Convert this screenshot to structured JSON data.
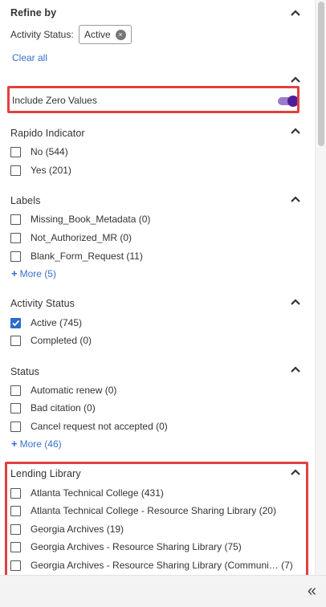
{
  "refine": {
    "title": "Refine by",
    "activity_label": "Activity Status:",
    "chip_value": "Active",
    "chip_remove": "×",
    "clear_all": "Clear all"
  },
  "zero": {
    "label": "Include Zero Values",
    "toggle_on": true
  },
  "rapido": {
    "title": "Rapido Indicator",
    "options": [
      "No (544)",
      "Yes (201)"
    ]
  },
  "labels": {
    "title": "Labels",
    "options": [
      "Missing_Book_Metadata (0)",
      "Not_Authorized_MR (0)",
      "Blank_Form_Request (11)"
    ],
    "more": "More (5)"
  },
  "activity_status": {
    "title": "Activity Status",
    "options": [
      "Active (745)",
      "Completed (0)"
    ],
    "checked": [
      true,
      false
    ]
  },
  "status": {
    "title": "Status",
    "options": [
      "Automatic renew (0)",
      "Bad citation (0)",
      "Cancel request not accepted (0)"
    ],
    "more": "More (46)"
  },
  "lending": {
    "title": "Lending Library",
    "options": [
      "Atlanta Technical College (431)",
      "Atlanta Technical College - Resource Sharing Library (20)",
      "Georgia Archives (19)",
      "Georgia Archives - Resource Sharing Library (75)",
      "Georgia Archives - Resource Sharing Library (Communi…  (7)"
    ]
  },
  "footer": {
    "collapse": "«"
  },
  "colors": {
    "highlight": "#e14040",
    "link": "#3a6fd0",
    "checkbox_checked": "#2d6bd0",
    "toggle_knob": "#4b1f9a"
  }
}
